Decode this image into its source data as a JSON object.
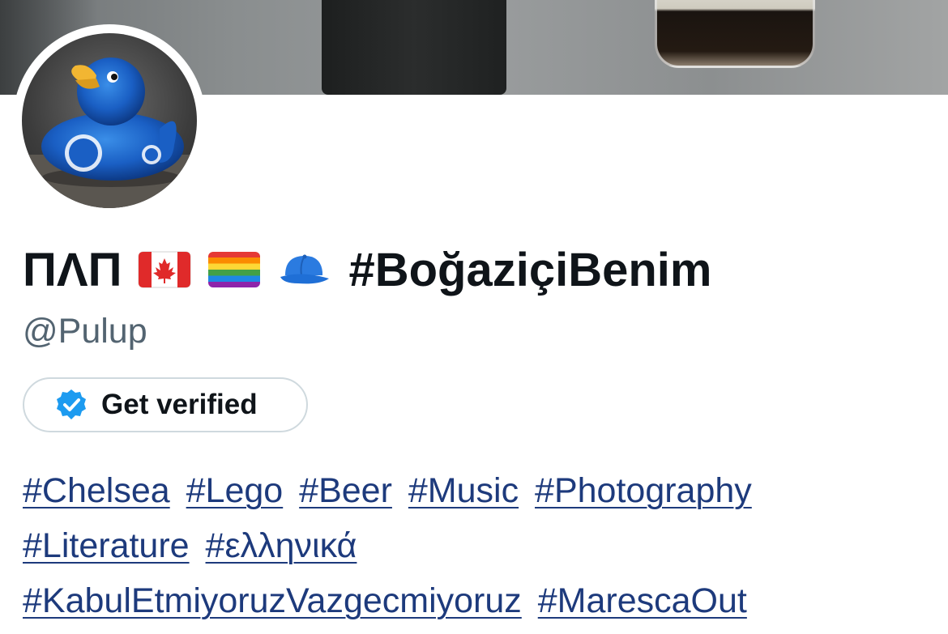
{
  "profile": {
    "display_name": "ΠΛΠ",
    "display_name_emojis": [
      "canada-flag-icon",
      "rainbow-flag-icon",
      "blue-cap-icon"
    ],
    "display_name_hashtag": "#BoğaziçiBenim",
    "handle": "@Pulup",
    "verify_button_label": "Get verified",
    "bio_hashtags": [
      "#Chelsea",
      "#Lego",
      "#Beer",
      "#Music",
      "#Photography",
      "#Literature",
      "#ελληνικά",
      "#KabulEtmiyoruzVazgecmiyoruz",
      "#MarescaOut"
    ]
  },
  "colors": {
    "text_primary": "#0f1419",
    "text_secondary": "#536471",
    "link": "#1d3a7c",
    "verified_blue": "#1d9bf0",
    "button_border": "#cfd9de"
  }
}
